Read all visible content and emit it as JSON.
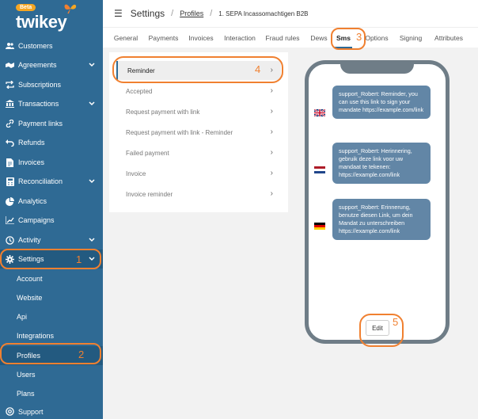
{
  "brand": {
    "badge": "Beta",
    "name": "twikey"
  },
  "sidebar": {
    "items": [
      {
        "label": "Customers",
        "icon": "users-icon"
      },
      {
        "label": "Agreements",
        "icon": "handshake-icon"
      },
      {
        "label": "Subscriptions",
        "icon": "repeat-icon"
      },
      {
        "label": "Transactions",
        "icon": "bank-icon"
      },
      {
        "label": "Payment links",
        "icon": "link-icon"
      },
      {
        "label": "Refunds",
        "icon": "undo-icon"
      },
      {
        "label": "Invoices",
        "icon": "document-icon"
      },
      {
        "label": "Reconciliation",
        "icon": "calculator-icon"
      },
      {
        "label": "Analytics",
        "icon": "analytics-icon"
      },
      {
        "label": "Campaigns",
        "icon": "chart-icon"
      },
      {
        "label": "Activity",
        "icon": "clock-icon"
      },
      {
        "label": "Settings",
        "icon": "gear-icon"
      }
    ],
    "sub_items": [
      "Account",
      "Website",
      "Api",
      "Integrations",
      "Profiles",
      "Users",
      "Plans"
    ],
    "support": "Support"
  },
  "header": {
    "title": "Settings",
    "crumb_link": "Profiles",
    "crumb_current": "1. SEPA Incassomachtigen B2B"
  },
  "tabs": [
    "General",
    "Payments",
    "Invoices",
    "Interaction",
    "Fraud rules",
    "Dews",
    "Sms",
    "Options",
    "Signing",
    "Attributes"
  ],
  "templates": [
    "Reminder",
    "Accepted",
    "Request payment with link",
    "Request payment with link - Reminder",
    "Failed payment",
    "Invoice",
    "Invoice reminder"
  ],
  "messages": [
    {
      "lang": "en",
      "text": "support_Robert: Reminder, you can use this link to sign your mandate https://example.com/link"
    },
    {
      "lang": "nl",
      "text": "support_Robert: Herinnering, gebruik deze link voor uw mandaat te tekenen: https://example.com/link"
    },
    {
      "lang": "de",
      "text": "support_Robert: Erinnerung, benutze diesen Link, um dein Mandat zu unterschreiben https://example.com/link"
    }
  ],
  "edit_label": "Edit",
  "annotations": [
    "1",
    "2",
    "3",
    "4",
    "5"
  ],
  "colors": {
    "sidebar": "#2f6a94",
    "annotation": "#f08030",
    "bubble": "#6286a6",
    "phone": "#6f7d87"
  }
}
